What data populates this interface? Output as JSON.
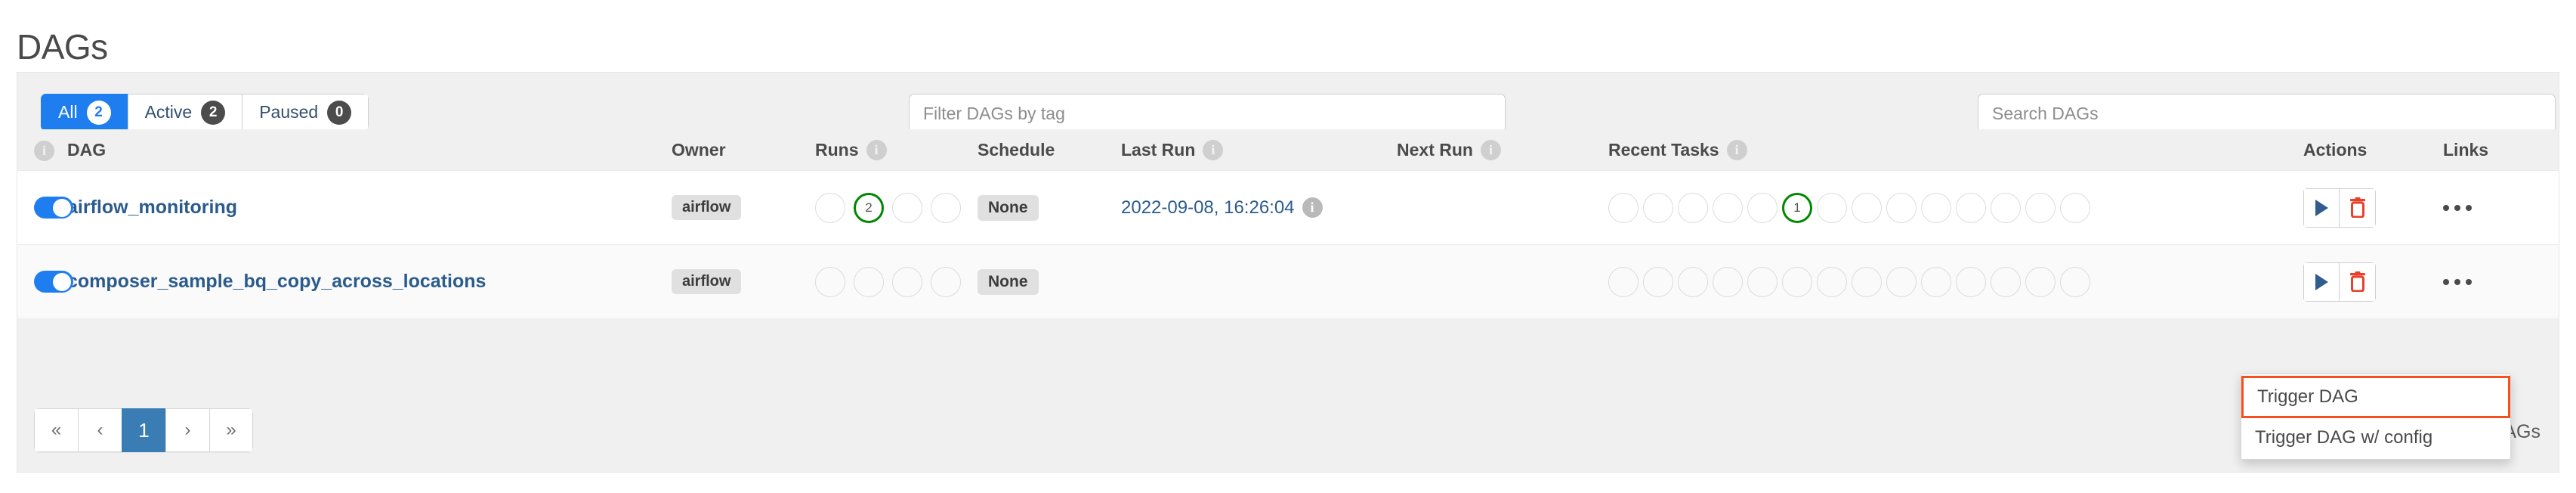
{
  "page": {
    "title": "DAGs"
  },
  "toolbar": {
    "tabs": [
      {
        "label": "All",
        "count": "2",
        "active": true
      },
      {
        "label": "Active",
        "count": "2",
        "active": false
      },
      {
        "label": "Paused",
        "count": "0",
        "active": false
      }
    ],
    "filter_tags_placeholder": "Filter DAGs by tag",
    "search_placeholder": "Search DAGs",
    "filter_tags_value": "",
    "search_value": ""
  },
  "table": {
    "headers": {
      "info_icon": "info-icon",
      "dag": "DAG",
      "owner": "Owner",
      "runs": "Runs",
      "schedule": "Schedule",
      "last_run": "Last Run",
      "next_run": "Next Run",
      "recent_tasks": "Recent Tasks",
      "actions": "Actions",
      "links": "Links"
    },
    "rows": [
      {
        "toggle_on": true,
        "name": "airflow_monitoring",
        "owner": "airflow",
        "runs": [
          {
            "count": "",
            "state": "none"
          },
          {
            "count": "2",
            "state": "success"
          },
          {
            "count": "",
            "state": "none"
          },
          {
            "count": "",
            "state": "none"
          }
        ],
        "schedule": "None",
        "last_run": "2022-09-08, 16:26:04",
        "next_run": "",
        "recent_tasks": [
          {
            "count": "",
            "state": "none"
          },
          {
            "count": "",
            "state": "none"
          },
          {
            "count": "",
            "state": "none"
          },
          {
            "count": "",
            "state": "none"
          },
          {
            "count": "",
            "state": "none"
          },
          {
            "count": "1",
            "state": "success"
          },
          {
            "count": "",
            "state": "none"
          },
          {
            "count": "",
            "state": "none"
          },
          {
            "count": "",
            "state": "none"
          },
          {
            "count": "",
            "state": "none"
          },
          {
            "count": "",
            "state": "none"
          },
          {
            "count": "",
            "state": "none"
          },
          {
            "count": "",
            "state": "none"
          },
          {
            "count": "",
            "state": "none"
          }
        ],
        "actions": {
          "trigger": "play-icon",
          "delete": "trash-icon"
        },
        "links": "ellipsis-icon"
      },
      {
        "toggle_on": true,
        "name": "composer_sample_bq_copy_across_locations",
        "owner": "airflow",
        "runs": [
          {
            "count": "",
            "state": "none"
          },
          {
            "count": "",
            "state": "none"
          },
          {
            "count": "",
            "state": "none"
          },
          {
            "count": "",
            "state": "none"
          }
        ],
        "schedule": "None",
        "last_run": "",
        "next_run": "",
        "recent_tasks": [
          {
            "count": "",
            "state": "none"
          },
          {
            "count": "",
            "state": "none"
          },
          {
            "count": "",
            "state": "none"
          },
          {
            "count": "",
            "state": "none"
          },
          {
            "count": "",
            "state": "none"
          },
          {
            "count": "",
            "state": "none"
          },
          {
            "count": "",
            "state": "none"
          },
          {
            "count": "",
            "state": "none"
          },
          {
            "count": "",
            "state": "none"
          },
          {
            "count": "",
            "state": "none"
          },
          {
            "count": "",
            "state": "none"
          },
          {
            "count": "",
            "state": "none"
          },
          {
            "count": "",
            "state": "none"
          },
          {
            "count": "",
            "state": "none"
          }
        ],
        "actions": {
          "trigger": "play-icon",
          "delete": "trash-icon"
        },
        "links": "ellipsis-icon"
      }
    ]
  },
  "pagination": {
    "first": "«",
    "prev": "‹",
    "current": "1",
    "next": "›",
    "last": "»"
  },
  "footer": {
    "showing_text": "DAGs"
  },
  "dropdown": {
    "items": [
      {
        "label": "Trigger DAG",
        "highlighted": true
      },
      {
        "label": "Trigger DAG w/ config",
        "highlighted": false
      }
    ]
  },
  "colors": {
    "accent_blue": "#1e7ef0",
    "link_blue": "#2b5b8c",
    "success_green": "#018701",
    "danger_red": "#e8402a",
    "highlight_orange": "#f4511e",
    "panel_bg": "#f0f0f0"
  }
}
